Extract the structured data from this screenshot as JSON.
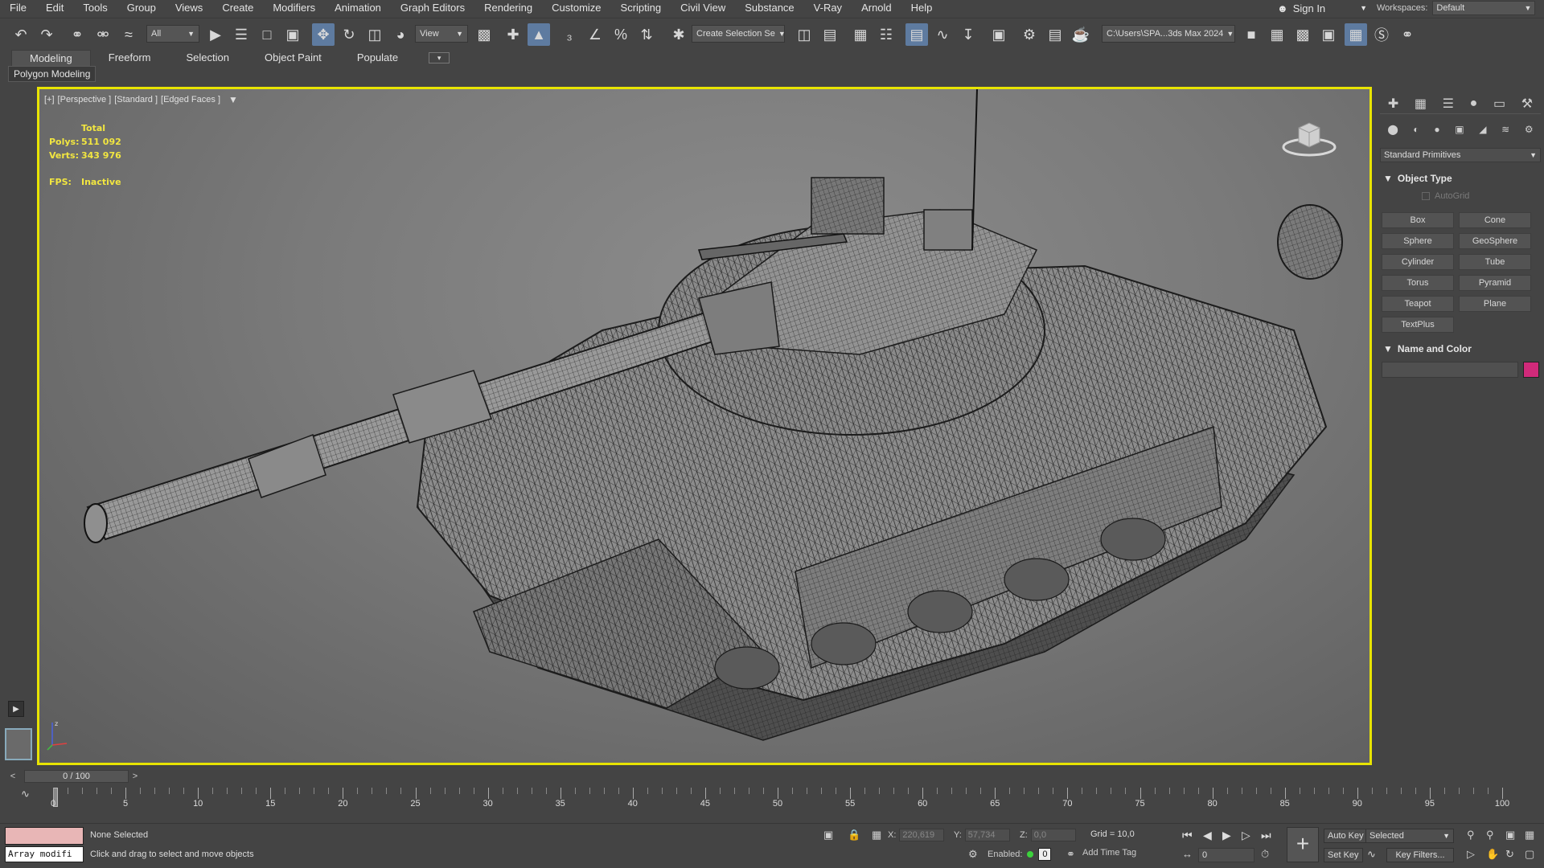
{
  "menu": [
    "File",
    "Edit",
    "Tools",
    "Group",
    "Views",
    "Create",
    "Modifiers",
    "Animation",
    "Graph Editors",
    "Rendering",
    "Customize",
    "Scripting",
    "Civil View",
    "Substance",
    "V-Ray",
    "Arnold",
    "Help"
  ],
  "signin": {
    "label": "Sign In"
  },
  "workspace": {
    "label": "Workspaces:",
    "value": "Default"
  },
  "toolbar": {
    "selection_filter": "All",
    "ref_coord": "View",
    "named_selection": "Create Selection Se",
    "project_path": "C:\\Users\\SPA...3ds Max 2024"
  },
  "ribbon": {
    "tabs": [
      "Modeling",
      "Freeform",
      "Selection",
      "Object Paint",
      "Populate"
    ],
    "active_tab": "Modeling",
    "sub_label": "Polygon Modeling"
  },
  "viewport": {
    "label_parts": [
      "[+]",
      "[Perspective ]",
      "[Standard ]",
      "[Edged Faces ]"
    ],
    "stats": {
      "total_label": "Total",
      "polys_label": "Polys:",
      "polys": "511 092",
      "verts_label": "Verts:",
      "verts": "343 976",
      "fps_label": "FPS:",
      "fps": "Inactive"
    },
    "border_color": "#e8e400"
  },
  "command_panel": {
    "dropdown": "Standard Primitives",
    "object_type_title": "Object Type",
    "autogrid": "AutoGrid",
    "buttons": [
      "Box",
      "Cone",
      "Sphere",
      "GeoSphere",
      "Cylinder",
      "Tube",
      "Torus",
      "Pyramid",
      "Teapot",
      "Plane",
      "TextPlus"
    ],
    "name_color_title": "Name and Color",
    "object_color": "#d12a7a"
  },
  "timeline": {
    "frame_display": "0 / 100",
    "ticks": [
      "0",
      "5",
      "10",
      "15",
      "20",
      "25",
      "30",
      "35",
      "40",
      "45",
      "50",
      "55",
      "60",
      "65",
      "70",
      "75",
      "80",
      "85",
      "90",
      "95",
      "100"
    ]
  },
  "status": {
    "selection": "None Selected",
    "prompt": "Click and drag to select and move objects",
    "maxscript": "Array modifi",
    "x_label": "X:",
    "x": "220,619",
    "y_label": "Y:",
    "y": "57,734",
    "z_label": "Z:",
    "z": "0,0",
    "grid": "Grid = 10,0",
    "enabled_label": "Enabled:",
    "enabled_value": "0",
    "add_time_tag": "Add Time Tag",
    "auto_key": "Auto Key",
    "key_mode": "Selected",
    "set_key": "Set Key",
    "key_filters": "Key Filters...",
    "current_frame": "0"
  }
}
